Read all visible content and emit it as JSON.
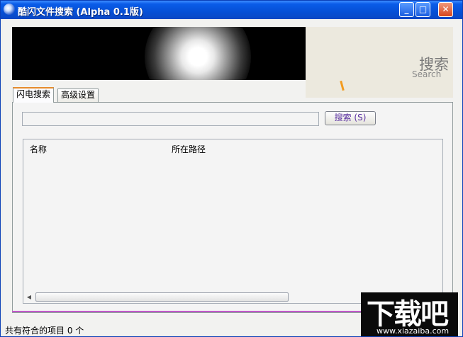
{
  "window": {
    "title": "酷闪文件搜索 (Alpha 0.1版)"
  },
  "logo": {
    "text": "搜索",
    "sub": "Search"
  },
  "tabs": [
    {
      "label": "闪电搜索"
    },
    {
      "label": "高级设置"
    }
  ],
  "search": {
    "value": "",
    "placeholder": "",
    "button_label": "搜索 (S)"
  },
  "results": {
    "columns": [
      "名称",
      "所在路径"
    ],
    "rows": []
  },
  "status": {
    "text": "共有符合的项目 0 个"
  },
  "watermark": {
    "text": "下载吧",
    "url": "www.xiazaiba.com"
  },
  "colors": {
    "titlebar": "#0a5ce8",
    "tab_accent": "#e68b2c",
    "divider": "#c058c8"
  }
}
